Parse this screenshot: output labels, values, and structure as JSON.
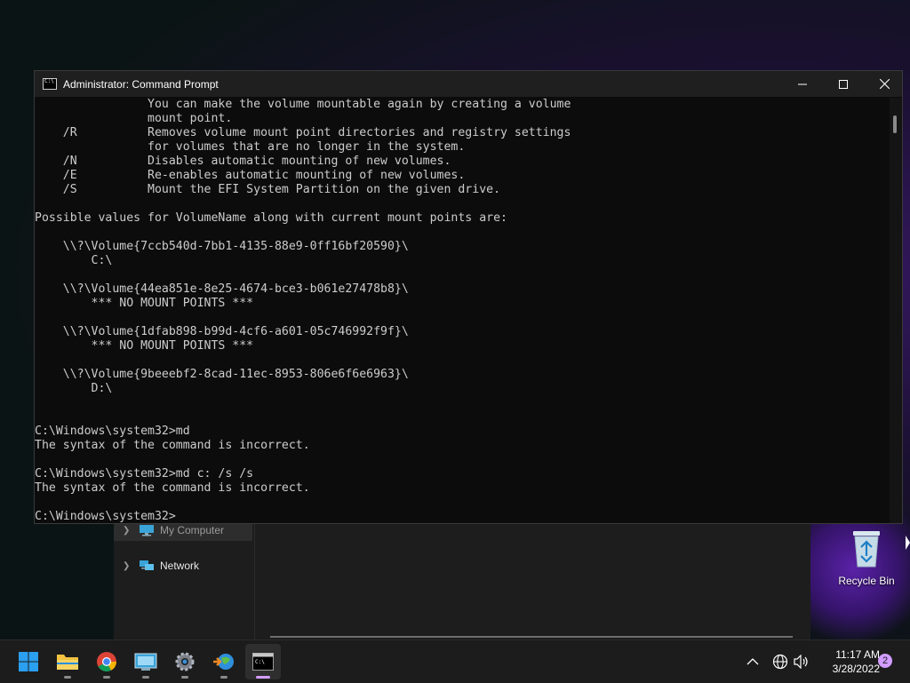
{
  "window": {
    "title": "Administrator: Command Prompt",
    "minimize_label": "–",
    "maximize_label": "☐",
    "close_label": "✕"
  },
  "console_lines": [
    "                You can make the volume mountable again by creating a volume",
    "                mount point.",
    "    /R          Removes volume mount point directories and registry settings",
    "                for volumes that are no longer in the system.",
    "    /N          Disables automatic mounting of new volumes.",
    "    /E          Re-enables automatic mounting of new volumes.",
    "    /S          Mount the EFI System Partition on the given drive.",
    "",
    "Possible values for VolumeName along with current mount points are:",
    "",
    "    \\\\?\\Volume{7ccb540d-7bb1-4135-88e9-0ff16bf20590}\\",
    "        C:\\",
    "",
    "    \\\\?\\Volume{44ea851e-8e25-4674-bce3-b061e27478b8}\\",
    "        *** NO MOUNT POINTS ***",
    "",
    "    \\\\?\\Volume{1dfab898-b99d-4cf6-a601-05c746992f9f}\\",
    "        *** NO MOUNT POINTS ***",
    "",
    "    \\\\?\\Volume{9beeebf2-8cad-11ec-8953-806e6f6e6963}\\",
    "        D:\\",
    "",
    "",
    "C:\\Windows\\system32>md",
    "The syntax of the command is incorrect.",
    "",
    "C:\\Windows\\system32>md c: /s /s",
    "The syntax of the command is incorrect.",
    "",
    "C:\\Windows\\system32>"
  ],
  "explorer": {
    "nav_items": [
      {
        "label": "My Computer",
        "icon": "computer-icon"
      },
      {
        "label": "Network",
        "icon": "network-icon"
      }
    ]
  },
  "desktop": {
    "recycle_bin_label": "Recycle Bin"
  },
  "taskbar": {
    "apps": [
      {
        "name": "start",
        "icon": "windows-start-icon"
      },
      {
        "name": "file-explorer",
        "icon": "folder-icon"
      },
      {
        "name": "chrome",
        "icon": "chrome-icon"
      },
      {
        "name": "control-panel",
        "icon": "control-panel-icon"
      },
      {
        "name": "settings",
        "icon": "gear-icon"
      },
      {
        "name": "network-app",
        "icon": "globe-arrow-icon"
      },
      {
        "name": "command-prompt",
        "icon": "terminal-icon"
      }
    ],
    "time": "11:17 AM",
    "date": "3/28/2022",
    "notification_count": "2"
  },
  "colors": {
    "console_bg": "#0c0c0c",
    "console_fg": "#cccccc",
    "accent": "#d29cff"
  }
}
